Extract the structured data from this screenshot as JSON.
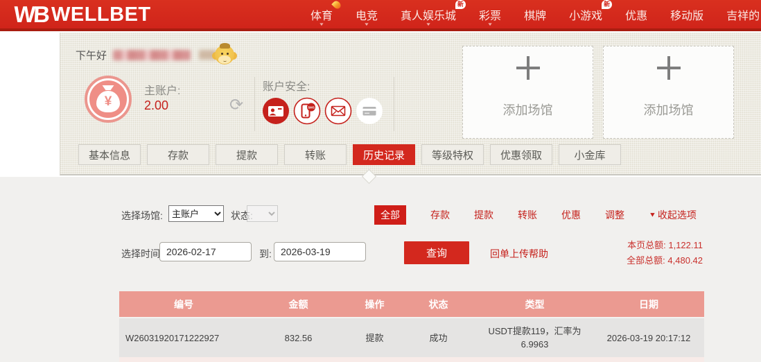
{
  "nav": {
    "logo_mark": "WB",
    "logo_text": "WELLBET",
    "new_badge_text": "新",
    "caret_char": "▼",
    "items": [
      {
        "label": "体育",
        "hot": true,
        "caret": true
      },
      {
        "label": "电竞",
        "caret": true
      },
      {
        "label": "真人娱乐城",
        "new": true,
        "caret": true
      },
      {
        "label": "彩票",
        "caret": true
      },
      {
        "label": "棋牌"
      },
      {
        "label": "小游戏",
        "new": true
      },
      {
        "label": "优惠"
      },
      {
        "label": "移动版"
      },
      {
        "label": "吉祥的"
      }
    ]
  },
  "account": {
    "greeting": "下午好",
    "main_label": "主账户:",
    "balance": "2.00",
    "moneybag_symbol": "¥",
    "security_label": "账户安全:",
    "security_icons": [
      "id-card-icon",
      "phone-sms-icon",
      "mail-icon",
      "bank-card-icon"
    ],
    "sms_text": "SMS",
    "add_venue_label": "添加场馆"
  },
  "tabs": [
    "基本信息",
    "存款",
    "提款",
    "转账",
    "历史记录",
    "等级特权",
    "优惠领取",
    "小金库"
  ],
  "history": {
    "venue_label": "选择场馆:",
    "venue_selected": "主账户",
    "status_label": "状态:",
    "type_filters": [
      "全部",
      "存款",
      "提款",
      "转账",
      "优惠",
      "调整"
    ],
    "active_type_filter": "全部",
    "collapse_caret": "▼",
    "collapse_label": "收起选项",
    "time_label": "选择时间:",
    "date_from": "2026-02-17",
    "to_label": "到:",
    "date_to": "2026-03-19",
    "query_button": "查询",
    "receipt_help_link": "回单上传帮助",
    "page_total_label": "本页总额:",
    "page_total_value": "1,122.11",
    "grand_total_label": "全部总额:",
    "grand_total_value": "4,480.42"
  },
  "table": {
    "headers": [
      "编号",
      "金额",
      "操作",
      "状态",
      "类型",
      "日期"
    ],
    "rows": [
      {
        "id": "W26031920171222927",
        "amount": "832.56",
        "operation": "提款",
        "status": "成功",
        "type": "USDT提款119，汇率为 6.9963",
        "date": "2026-03-19 20:17:12"
      }
    ]
  },
  "colors": {
    "nav_red": "#d5291e",
    "accent_red": "#d3281e",
    "link_red": "#c5211c",
    "table_header_salmon": "#eb9a91",
    "row_gray": "#e5e4e3",
    "panel_beige": "#edebe2"
  }
}
